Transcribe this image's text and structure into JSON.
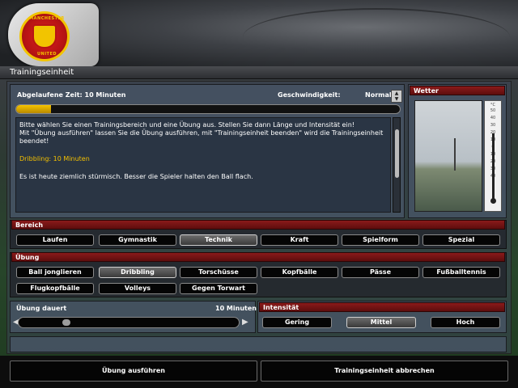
{
  "window_title": "Trainingseinheit",
  "logo": {
    "top_text": "MANCHESTER",
    "bottom_text": "UNITED"
  },
  "info": {
    "elapsed_label": "Abgelaufene Zeit: 10 Minuten",
    "speed_label": "Geschwindigkeit:",
    "speed_value": "Normal",
    "progress_fraction": 0.09,
    "message_line1": "Bitte wählen Sie einen Trainingsbereich und eine Übung aus. Stellen Sie dann Länge und Intensität ein!",
    "message_line2": "Mit \"Übung ausführen\" lassen Sie die Übung ausführen, mit \"Trainingseinheit beenden\" wird die Trainingseinheit beendet!",
    "selected_exercise": "Dribbling: 10 Minuten",
    "weather_note": "Es ist heute ziemlich stürmisch. Besser die Spieler halten den Ball flach."
  },
  "weather": {
    "title": "Wetter",
    "unit": "°C",
    "scale": [
      "50",
      "40",
      "30",
      "20",
      "10",
      "0",
      "10",
      "20",
      "30",
      "40"
    ]
  },
  "bereich": {
    "title": "Bereich",
    "items": [
      "Laufen",
      "Gymnastik",
      "Technik",
      "Kraft",
      "Spielform",
      "Spezial"
    ],
    "active": "Technik"
  },
  "uebung": {
    "title": "Übung",
    "row1": [
      "Ball jonglieren",
      "Dribbling",
      "Torschüsse",
      "Kopfbälle",
      "Pässe",
      "Fußballtennis"
    ],
    "row2": [
      "Flugkopfbälle",
      "Volleys",
      "Gegen Torwart"
    ],
    "active": "Dribbling"
  },
  "dauer": {
    "label": "Übung dauert",
    "value": "10 Minuten",
    "slider_fraction": 0.2
  },
  "intensitaet": {
    "title": "Intensität",
    "items": [
      "Gering",
      "Mittel",
      "Hoch"
    ],
    "active": "Mittel"
  },
  "bottom": {
    "execute": "Übung ausführen",
    "abort": "Trainingseinheit abbrechen"
  },
  "colors": {
    "accent_red": "#8a1a1a",
    "highlight_yellow": "#f3c000"
  }
}
